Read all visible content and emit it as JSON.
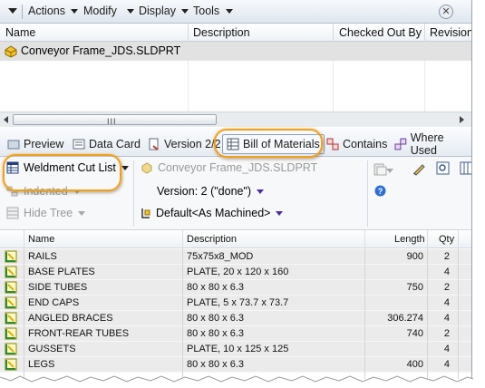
{
  "menu": {
    "items": [
      "Actions",
      "Modify",
      "Display",
      "Tools"
    ]
  },
  "file_list": {
    "columns": [
      "Name",
      "Description",
      "Checked Out By",
      "Revision"
    ],
    "rows": [
      {
        "name": "Conveyor Frame_JDS.SLDPRT"
      }
    ]
  },
  "tabs": [
    {
      "label": "Preview",
      "icon": "preview-icon"
    },
    {
      "label": "Data Card",
      "icon": "data-card-icon"
    },
    {
      "label": "Version 2/2",
      "icon": "version-icon"
    },
    {
      "label": "Bill of Materials",
      "icon": "bom-icon",
      "active": true
    },
    {
      "label": "Contains",
      "icon": "contains-icon"
    },
    {
      "label": "Where Used",
      "icon": "where-used-icon"
    }
  ],
  "bom_toolbar": {
    "bom_type": "Weldment Cut List",
    "indented": "Indented",
    "hide_tree": "Hide Tree",
    "file_name": "Conveyor Frame_JDS.SLDPRT",
    "version": "Version: 2 (\"done\")",
    "configuration": "Default<As Machined>"
  },
  "bom_table": {
    "columns": [
      "Name",
      "Description",
      "Length",
      "Qty"
    ],
    "rows": [
      {
        "name": "RAILS",
        "description": "75x75x8_MOD",
        "length": "900",
        "qty": "2"
      },
      {
        "name": "BASE PLATES",
        "description": "PLATE, 20 x 120 x 160",
        "length": "",
        "qty": "4"
      },
      {
        "name": "SIDE TUBES",
        "description": "80 x 80 x 6.3",
        "length": "750",
        "qty": "2"
      },
      {
        "name": "END CAPS",
        "description": "PLATE, 5 x 73.7 x 73.7",
        "length": "",
        "qty": "4"
      },
      {
        "name": "ANGLED BRACES",
        "description": "80 x 80 x 6.3",
        "length": "306.274",
        "qty": "4"
      },
      {
        "name": "FRONT-REAR TUBES",
        "description": "80 x 80 x 6.3",
        "length": "740",
        "qty": "2"
      },
      {
        "name": "GUSSETS",
        "description": "PLATE, 10 x 125 x 125",
        "length": "",
        "qty": "4"
      },
      {
        "name": "LEGS",
        "description": "80 x 80 x 6.3",
        "length": "400",
        "qty": "4"
      }
    ]
  },
  "colors": {
    "highlight_oval": "#f0a020",
    "selected_row": "#e2e2e2",
    "toolbar_bg": "#f7f8fa"
  }
}
